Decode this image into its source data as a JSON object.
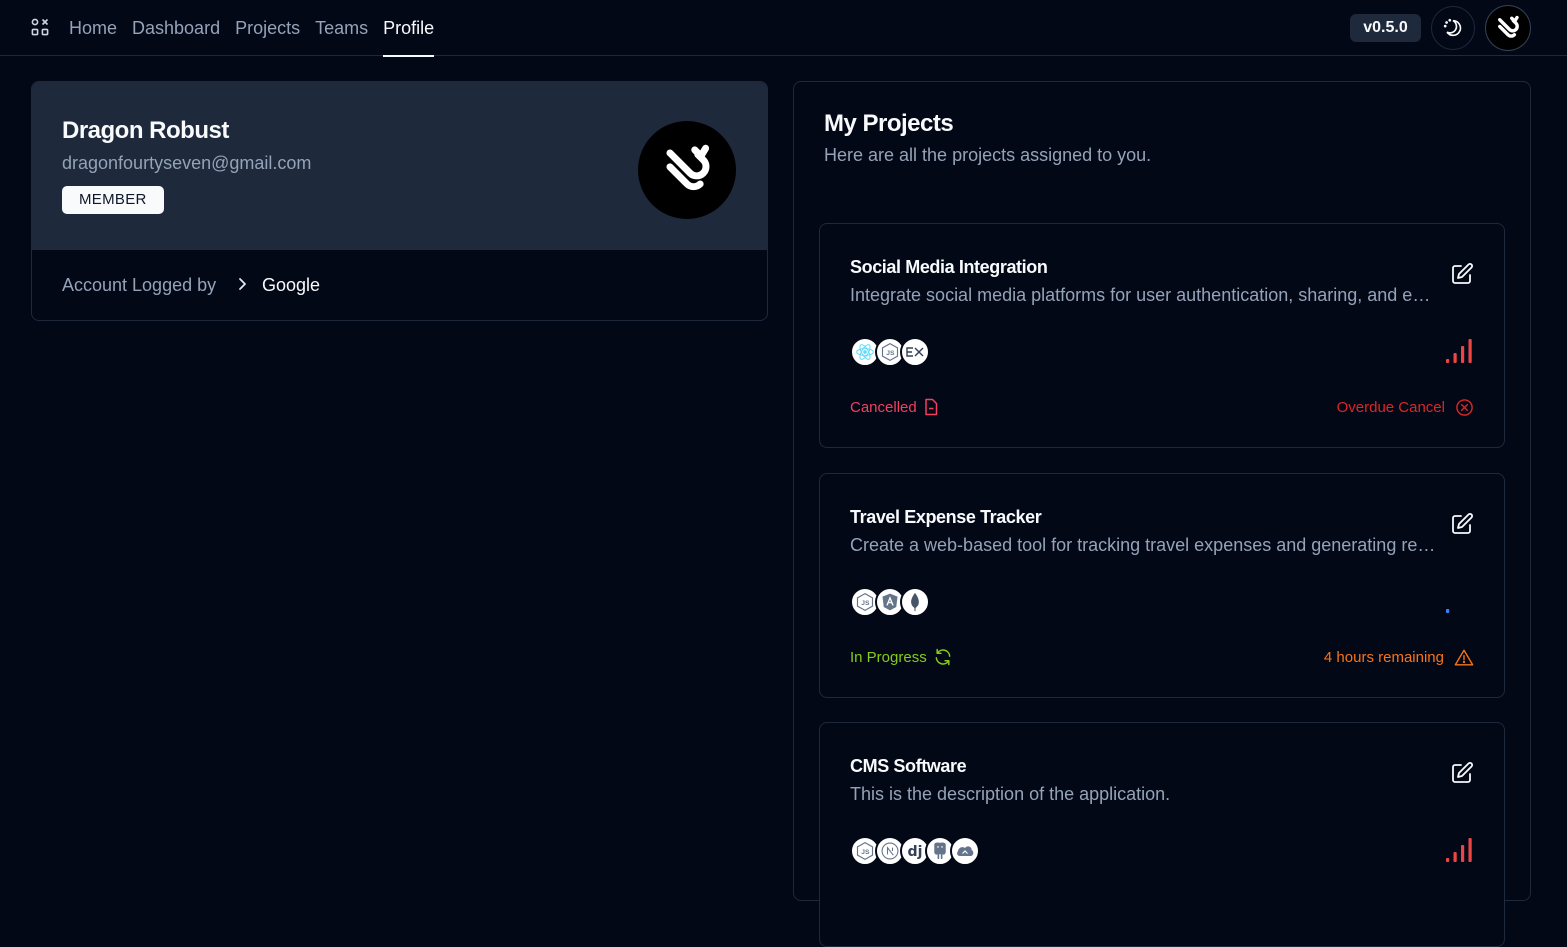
{
  "nav": {
    "logo_icon": "apps-grid-icon",
    "links": [
      {
        "label": "Home"
      },
      {
        "label": "Dashboard"
      },
      {
        "label": "Projects"
      },
      {
        "label": "Teams"
      },
      {
        "label": "Profile",
        "active": true
      }
    ],
    "version": "v0.5.0",
    "theme_icon": "moon-sun-icon"
  },
  "profile": {
    "name": "Dragon Robust",
    "email": "dragonfourtyseven@gmail.com",
    "role": "MEMBER",
    "logged_label": "Account Logged by",
    "provider": "Google"
  },
  "projects": {
    "title": "My Projects",
    "subtitle": "Here are all the projects assigned to you.",
    "items": [
      {
        "title": "Social Media Integration",
        "description": "Integrate social media platforms for user authentication, sharing, and engagement features.",
        "tech": [
          "react-icon",
          "nodejs-icon",
          "express-icon"
        ],
        "priority": "high",
        "priority_level_of_4": 4,
        "priority_color": "#ef4444",
        "status": "Cancelled",
        "status_color": "#f43f5e",
        "status_icon": "file-icon",
        "deadline": "Overdue Cancel",
        "deadline_color": "#dc2626",
        "deadline_icon": "x-circle-icon"
      },
      {
        "title": "Travel Expense Tracker",
        "description": "Create a web-based tool for tracking travel expenses and generating reports.",
        "tech": [
          "nodejs-icon",
          "angular-icon",
          "mongodb-icon"
        ],
        "priority": "low",
        "priority_level_of_4": 1,
        "priority_color": "#3b82f6",
        "status": "In Progress",
        "status_color": "#84cc16",
        "status_icon": "refresh-icon",
        "deadline": "4 hours remaining",
        "deadline_color": "#f97316",
        "deadline_icon": "warning-triangle-icon"
      },
      {
        "title": "CMS Software",
        "description": "This is the description of the application.",
        "tech": [
          "nodejs-icon",
          "nextjs-icon",
          "django-icon",
          "postgresql-icon",
          "cloud-icon"
        ],
        "priority": "high",
        "priority_level_of_4": 4,
        "priority_color": "#ef4444"
      }
    ]
  }
}
